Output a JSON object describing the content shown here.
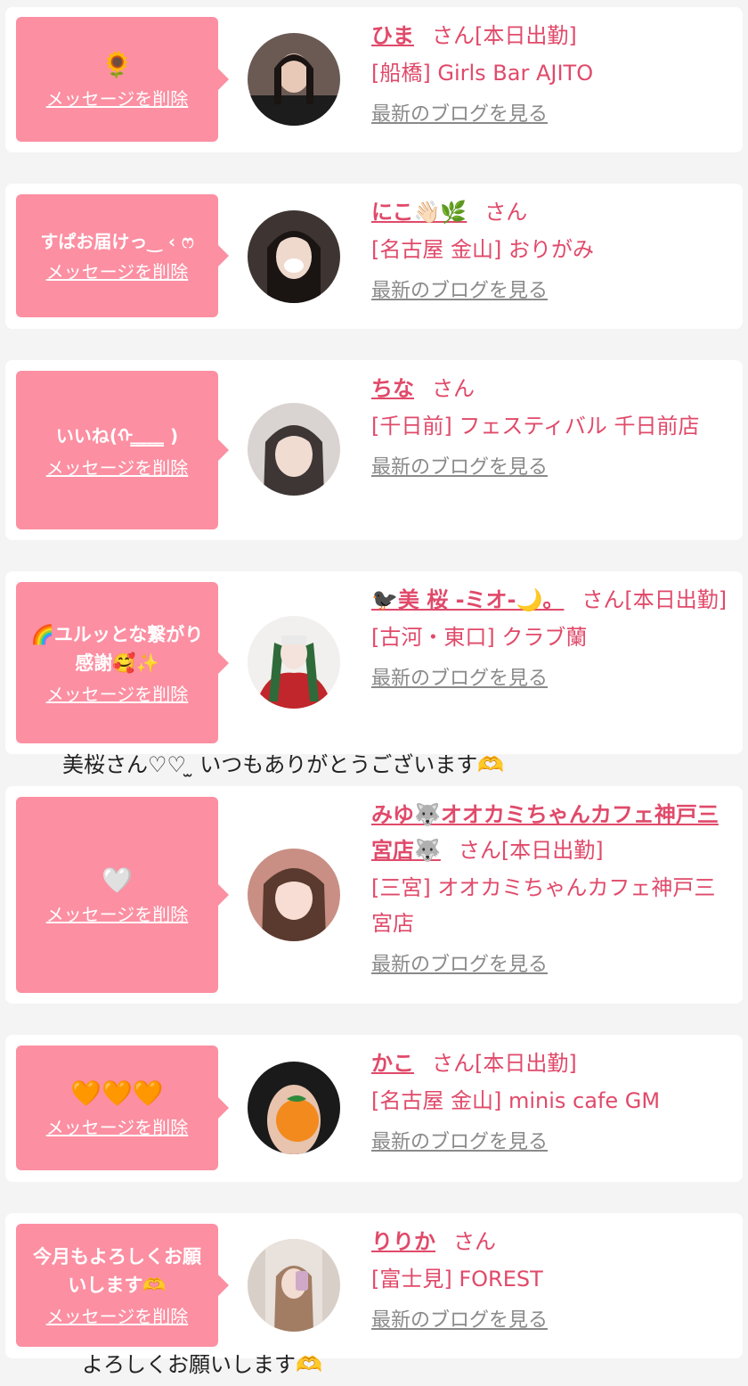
{
  "entries": [
    {
      "message": "🌻",
      "message_emoji": true,
      "delete_label": "メッセージを削除",
      "name": "ひま",
      "honorific": "さん",
      "status": "[本日出勤]",
      "shop": "[船橋] Girls Bar AJITO",
      "blog_label": "最新のブログを見る"
    },
    {
      "message": "すぱお届けっ‿ ‹ ෆ",
      "message_emoji": false,
      "delete_label": "メッセージを削除",
      "name": "にこ👋🏻🌿",
      "honorific": "さん",
      "status": "",
      "shop": "[名古屋 金山] おりがみ",
      "blog_label": "最新のブログを見る"
    },
    {
      "message": "いいね(ᡣ ̳ ̳ ̳ ̳ ̳ )",
      "message_emoji": false,
      "delete_label": "メッセージを削除",
      "name": "ちな",
      "honorific": "さん",
      "status": "",
      "shop": "[千日前] フェスティバル 千日前店",
      "blog_label": "最新のブログを見る"
    },
    {
      "message": "🌈ユルッとな繋がり感謝🥰✨",
      "message_emoji": false,
      "delete_label": "メッセージを削除",
      "name": "🐦‍⬛美 桜 -ミオ-🌙。",
      "honorific": "さん",
      "status": "[本日出勤]",
      "shop": "[古河・東口] クラブ蘭",
      "blog_label": "最新のブログを見る"
    },
    {
      "message": "🤍",
      "message_emoji": true,
      "delete_label": "メッセージを削除",
      "name": "みゆ🐺オオカミちゃんカフェ神戸三宮店🐺",
      "honorific": "さん",
      "status": "[本日出勤]",
      "shop": "[三宮] オオカミちゃんカフェ神戸三宮店",
      "blog_label": "最新のブログを見る"
    },
    {
      "message": "🧡🧡🧡",
      "message_emoji": true,
      "delete_label": "メッセージを削除",
      "name": "かこ",
      "honorific": "さん",
      "status": "[本日出勤]",
      "shop": "[名古屋 金山] minis cafe GM",
      "blog_label": "最新のブログを見る"
    },
    {
      "message": "今月もよろしくお願いします🫶",
      "message_emoji": false,
      "delete_label": "メッセージを削除",
      "name": "りりか",
      "honorific": "さん",
      "status": "",
      "shop": "[富士見] FOREST",
      "blog_label": "最新のブログを見る"
    }
  ],
  "captions": [
    "美桜さん♡♡ ̫ いつもありがとうございます🫶",
    "よろしくお願いします🫶"
  ],
  "colors": {
    "bubble": "#fc8fa2",
    "name": "#e04a6a",
    "link_gray": "#8a8a8a",
    "background": "#f4f4f4"
  }
}
